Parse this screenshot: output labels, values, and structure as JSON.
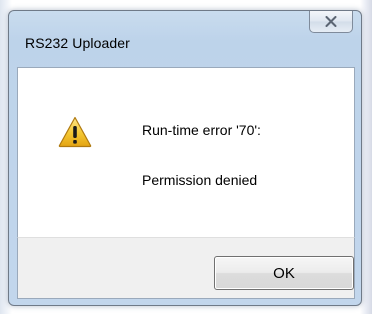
{
  "window": {
    "title": "RS232 Uploader",
    "close_icon": "close-icon"
  },
  "message": {
    "icon": "warning-icon",
    "line1": "Run-time error '70':",
    "line2": "Permission denied"
  },
  "buttons": {
    "ok_label": "OK"
  },
  "colors": {
    "titlebar": "#bdd3ea",
    "content_bg": "#ffffff",
    "footer_bg": "#f0f0f0",
    "warning_yellow": "#f2c230"
  }
}
